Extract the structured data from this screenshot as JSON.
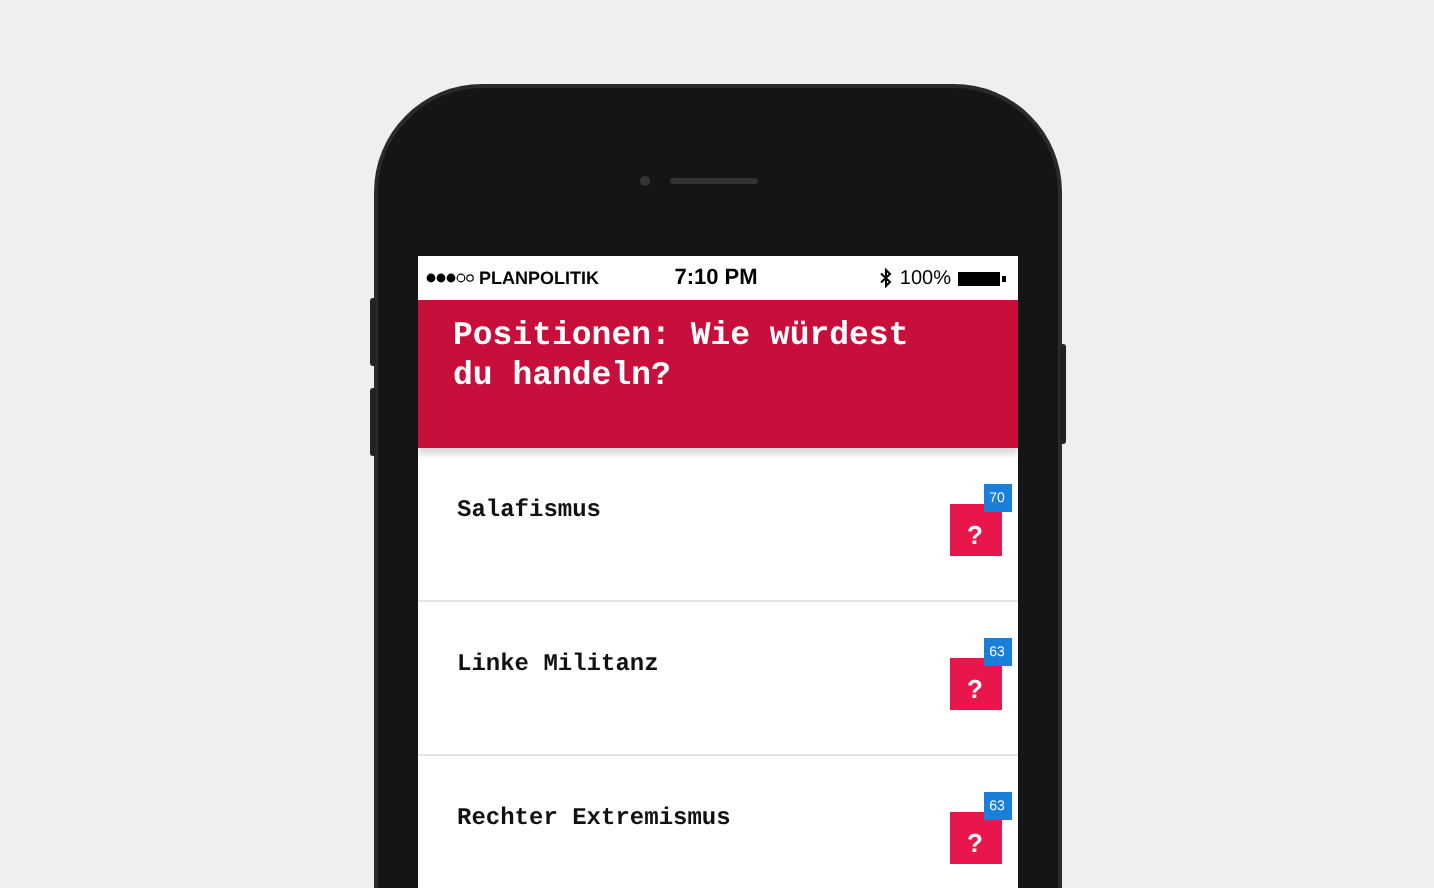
{
  "status_bar": {
    "carrier": "PLANPOLITIK",
    "time": "7:10 PM",
    "battery": "100%"
  },
  "header": {
    "title": "Positionen: Wie würdest du handeln?"
  },
  "topics": [
    {
      "title": "Salafismus",
      "icon": "?",
      "count": "70"
    },
    {
      "title": "Linke Militanz",
      "icon": "?",
      "count": "63"
    },
    {
      "title": "Rechter Extremismus",
      "icon": "?",
      "count": "63"
    }
  ]
}
